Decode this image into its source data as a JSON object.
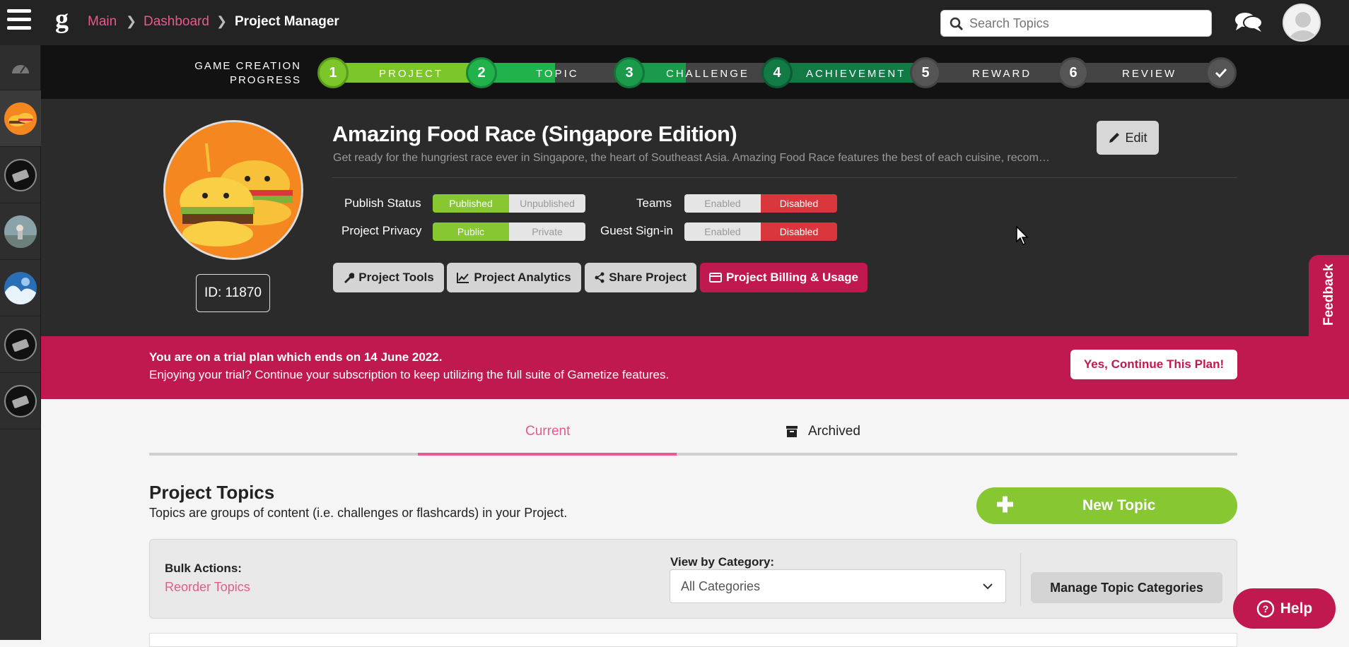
{
  "topbar": {
    "breadcrumb": [
      "Main",
      "Dashboard",
      "Project Manager"
    ],
    "search_placeholder": "Search Topics"
  },
  "progress": {
    "label_line1": "GAME CREATION",
    "label_line2": "PROGRESS",
    "steps": [
      {
        "num": "1",
        "label": "PROJECT"
      },
      {
        "num": "2",
        "label": "TOPIC"
      },
      {
        "num": "3",
        "label": "CHALLENGE"
      },
      {
        "num": "4",
        "label": "ACHIEVEMENT"
      },
      {
        "num": "5",
        "label": "REWARD"
      },
      {
        "num": "6",
        "label": "REVIEW"
      }
    ],
    "colors": {
      "step1": "#7cc52a",
      "step2": "#22b24c",
      "step3": "#1a9a4a",
      "step4": "#117a45",
      "pending": "#555555"
    }
  },
  "project": {
    "title": "Amazing Food Race (Singapore Edition)",
    "description": "Get ready for the hungriest race ever in Singapore, the heart of Southeast Asia. Amazing Food Race features the best of each cuisine, recom…",
    "id_label": "ID: 11870",
    "edit_label": "Edit",
    "publish_status_label": "Publish Status",
    "publish_on": "Published",
    "publish_off": "Unpublished",
    "privacy_label": "Project Privacy",
    "privacy_on": "Public",
    "privacy_off": "Private",
    "teams_label": "Teams",
    "teams_enabled": "Enabled",
    "teams_disabled": "Disabled",
    "guest_label": "Guest Sign-in",
    "guest_enabled": "Enabled",
    "guest_disabled": "Disabled",
    "tools": [
      "Project Tools",
      "Project Analytics",
      "Share Project",
      "Project Billing & Usage"
    ]
  },
  "feedback_label": "Feedback",
  "trial": {
    "line1": "You are on a trial plan which ends on 14 June 2022.",
    "line2": "Enjoying your trial? Continue your subscription to keep utilizing the full suite of Gametize features.",
    "button": "Yes, Continue This Plan!"
  },
  "tabs": {
    "current": "Current",
    "archived": "Archived"
  },
  "topics": {
    "title": "Project Topics",
    "subtitle": "Topics are groups of content (i.e. challenges or flashcards) in your Project.",
    "new_topic": "New Topic",
    "bulk_label": "Bulk Actions:",
    "reorder": "Reorder Topics",
    "view_label": "View by Category:",
    "category_selected": "All Categories",
    "manage_categories": "Manage Topic Categories"
  },
  "help_label": "Help"
}
